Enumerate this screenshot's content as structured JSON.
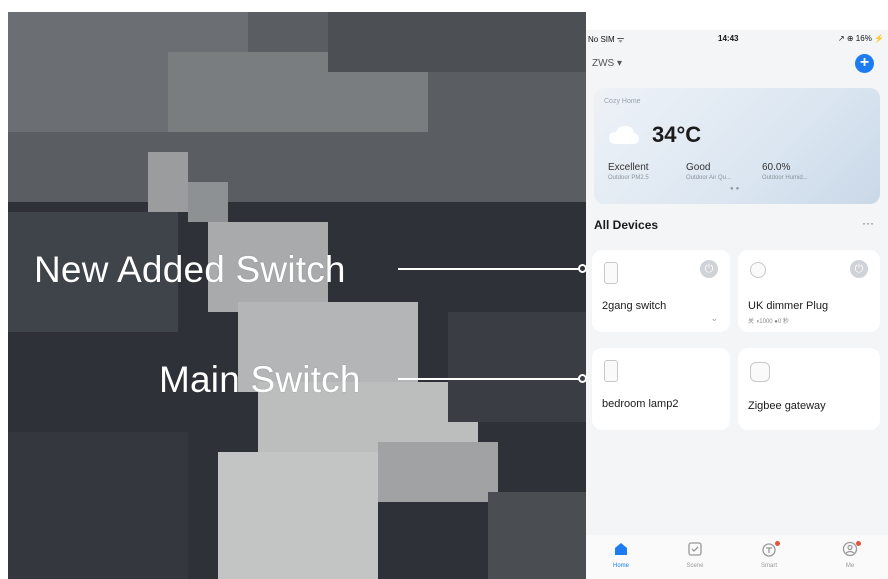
{
  "annotations": {
    "new_switch": "New Added Switch",
    "main_switch": "Main Switch"
  },
  "status_bar": {
    "carrier": "No SIM ᯤ",
    "time": "14:43",
    "right": "↗ ⊕ 16% ⚡"
  },
  "header": {
    "home_name": "ZWS ▾",
    "add_icon": "plus-icon"
  },
  "weather": {
    "home": "Cozy Home",
    "temperature": "34°C",
    "stats": [
      {
        "value": "Excellent",
        "label": "Outdoor PM2.5"
      },
      {
        "value": "Good",
        "label": "Outdoor Air Qu..."
      },
      {
        "value": "60.0%",
        "label": "Outdoor Humid..."
      }
    ]
  },
  "devices": {
    "title": "All Devices",
    "more": "···",
    "items": [
      {
        "name": "2gang switch",
        "info": ""
      },
      {
        "name": "UK dimmer Plug",
        "info": "关 ◑1000 ●0 秒"
      },
      {
        "name": "bedroom lamp2",
        "info": ""
      },
      {
        "name": "Zigbee gateway",
        "info": ""
      }
    ]
  },
  "tabs": [
    {
      "label": "Home",
      "icon": "home-icon"
    },
    {
      "label": "Scene",
      "icon": "scene-icon"
    },
    {
      "label": "Smart",
      "icon": "smart-icon"
    },
    {
      "label": "Me",
      "icon": "profile-icon"
    }
  ],
  "colors": {
    "accent": "#1e7cf2",
    "badge": "#e5533d"
  }
}
